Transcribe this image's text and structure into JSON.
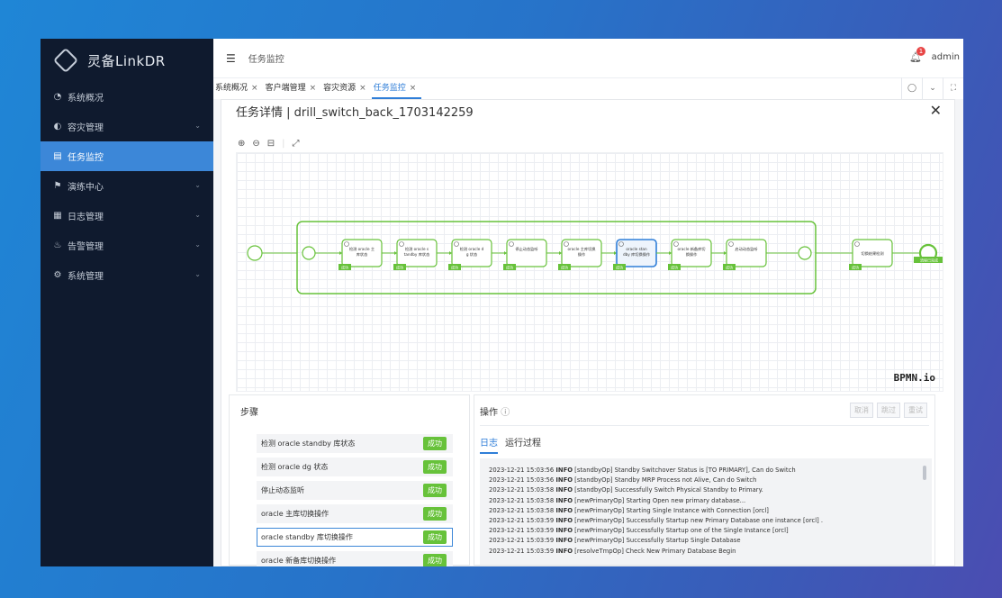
{
  "app": {
    "brand": "灵备LinkDR"
  },
  "sidebar": {
    "items": [
      {
        "icon": "dashboard-icon",
        "glyph": "◔",
        "label": "系统概况",
        "active": false,
        "chevron": false
      },
      {
        "icon": "disaster-icon",
        "glyph": "◐",
        "label": "容灾管理",
        "active": false,
        "chevron": true
      },
      {
        "icon": "monitor-icon",
        "glyph": "▤",
        "label": "任务监控",
        "active": true,
        "chevron": false
      },
      {
        "icon": "drill-icon",
        "glyph": "⚑",
        "label": "演练中心",
        "active": false,
        "chevron": true
      },
      {
        "icon": "log-icon",
        "glyph": "▦",
        "label": "日志管理",
        "active": false,
        "chevron": true
      },
      {
        "icon": "alert-icon",
        "glyph": "♨",
        "label": "告警管理",
        "active": false,
        "chevron": true
      },
      {
        "icon": "settings-icon",
        "glyph": "⚙",
        "label": "系统管理",
        "active": false,
        "chevron": true
      }
    ]
  },
  "topbar": {
    "breadcrumb": "任务监控",
    "user": "admin",
    "notifications": "1"
  },
  "tabs": [
    {
      "label": "系统概况",
      "active": false
    },
    {
      "label": "客户端管理",
      "active": false
    },
    {
      "label": "容灾资源",
      "active": false
    },
    {
      "label": "任务监控",
      "active": true
    }
  ],
  "panel": {
    "title": "任务详情 | drill_switch_back_1703142259",
    "watermark": "BPMN.io"
  },
  "flow": {
    "tasks": [
      {
        "label": "检测 oracle 主库状态",
        "status": "成功",
        "selected": false
      },
      {
        "label": "检测 oracle standby 库状态",
        "status": "成功",
        "selected": false
      },
      {
        "label": "检测 oracle dg 状态",
        "status": "成功",
        "selected": false
      },
      {
        "label": "停止动态监听",
        "status": "成功",
        "selected": false
      },
      {
        "label": "oracle 主库切换操作",
        "status": "成功",
        "selected": false
      },
      {
        "label": "oracle standby 库切换操作",
        "status": "成功",
        "selected": true
      },
      {
        "label": "oracle 新备库切换操作",
        "status": "成功",
        "selected": false
      },
      {
        "label": "启动动态监听",
        "status": "成功",
        "selected": false
      }
    ],
    "final_task": {
      "label": "切换结果检测",
      "status": "成功"
    },
    "end_label": "流程已完成"
  },
  "steps": {
    "title": "步骤",
    "items": [
      {
        "label": "检测 oracle standby 库状态",
        "status": "成功",
        "active": false
      },
      {
        "label": "检测 oracle dg 状态",
        "status": "成功",
        "active": false
      },
      {
        "label": "停止动态监听",
        "status": "成功",
        "active": false
      },
      {
        "label": "oracle 主库切换操作",
        "status": "成功",
        "active": false
      },
      {
        "label": "oracle standby 库切换操作",
        "status": "成功",
        "active": true
      },
      {
        "label": "oracle 新备库切换操作",
        "status": "成功",
        "active": false
      }
    ]
  },
  "ops": {
    "title": "操作",
    "buttons": [
      "取消",
      "跳过",
      "重试"
    ],
    "tabs": [
      {
        "label": "日志",
        "active": true
      },
      {
        "label": "运行过程",
        "active": false
      }
    ],
    "logs": [
      {
        "time": "2023-12-21 15:03:56",
        "level": "INFO",
        "text": "[standbyOp] Standby Switchover Status is [TO PRIMARY], Can do Switch"
      },
      {
        "time": "2023-12-21 15:03:56",
        "level": "INFO",
        "text": "[standbyOp] Standby MRP Process not Alive, Can do Switch"
      },
      {
        "time": "2023-12-21 15:03:58",
        "level": "INFO",
        "text": "[standbyOp] Successfully Switch Physical Standby to Primary."
      },
      {
        "time": "2023-12-21 15:03:58",
        "level": "INFO",
        "text": "[newPrimaryOp] Starting Open new primary database..."
      },
      {
        "time": "2023-12-21 15:03:58",
        "level": "INFO",
        "text": "[newPrimaryOp] Starting Single Instance with Connection [orcl]"
      },
      {
        "time": "2023-12-21 15:03:59",
        "level": "INFO",
        "text": "[newPrimaryOp] Successfully Startup new Primary Database one instance [orcl] ."
      },
      {
        "time": "2023-12-21 15:03:59",
        "level": "INFO",
        "text": "[newPrimaryOp] Successfully Startup one of the Single Instance [orcl]"
      },
      {
        "time": "2023-12-21 15:03:59",
        "level": "INFO",
        "text": "[newPrimaryOp] Successfully Startup Single Database"
      },
      {
        "time": "2023-12-21 15:03:59",
        "level": "INFO",
        "text": "[resolveTmpOp] Check New Primary Database Begin"
      }
    ]
  },
  "colors": {
    "accent": "#3c87d8",
    "success": "#67c23a",
    "flowline": "#67c23a",
    "sidebar": "#0f1a2e"
  }
}
